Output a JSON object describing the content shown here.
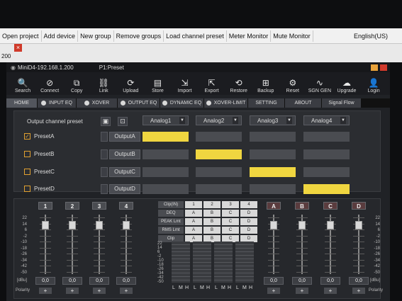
{
  "menu": [
    "Open project",
    "Add device",
    "New group",
    "Remove groups",
    "Load channel preset",
    "Meter Monitor",
    "Mute Monitor"
  ],
  "language": "English(US)",
  "bg_number": "200",
  "window": {
    "title": "MiniD4-192.168.1.200",
    "preset": "P1:Preset"
  },
  "toolbar": [
    {
      "label": "Search",
      "icon": "search-icon",
      "glyph": "🔍"
    },
    {
      "label": "Connect",
      "icon": "connect-icon",
      "glyph": "⊘"
    },
    {
      "label": "Copy",
      "icon": "copy-icon",
      "glyph": "⧉"
    },
    {
      "label": "Link",
      "icon": "link-icon",
      "glyph": "⛓"
    },
    {
      "label": "Upload",
      "icon": "upload-icon",
      "glyph": "⟳"
    },
    {
      "label": "Store",
      "icon": "store-icon",
      "glyph": "▤"
    },
    {
      "label": "Import",
      "icon": "import-icon",
      "glyph": "⇲"
    },
    {
      "label": "Export",
      "icon": "export-icon",
      "glyph": "⇱"
    },
    {
      "label": "Restore",
      "icon": "restore-icon",
      "glyph": "⟲"
    },
    {
      "label": "Backup",
      "icon": "backup-icon",
      "glyph": "⊞"
    },
    {
      "label": "Reset",
      "icon": "reset-icon",
      "glyph": "⚙"
    },
    {
      "label": "SGN GEN",
      "icon": "signal-gen-icon",
      "glyph": "∿"
    },
    {
      "label": "Upgrade",
      "icon": "upgrade-icon",
      "glyph": "☁"
    },
    {
      "label": "Login",
      "icon": "login-icon",
      "glyph": "👤"
    }
  ],
  "tabs": [
    {
      "label": "HOME",
      "active": true,
      "dot": false
    },
    {
      "label": "INPUT EQ",
      "dot": true
    },
    {
      "label": "XOVER",
      "dot": true
    },
    {
      "label": "OUTPUT EQ",
      "dot": true
    },
    {
      "label": "DYNAMIC EQ",
      "dot": true
    },
    {
      "label": "XOVER-LIMIT",
      "dot": true
    },
    {
      "label": "SETTING",
      "dot": false
    },
    {
      "label": "ABOUT",
      "dot": false
    },
    {
      "label": "Signal Flow",
      "dot": false
    }
  ],
  "routing": {
    "header_label": "Output channel preset",
    "inputs": [
      "Analog1",
      "Analog2",
      "Analog3",
      "Analog4"
    ],
    "presets": [
      {
        "name": "PresetA",
        "output": "OutputA",
        "checked": true,
        "assigned": 0
      },
      {
        "name": "PresetB",
        "output": "OutputB",
        "checked": false,
        "assigned": 1
      },
      {
        "name": "PresetC",
        "output": "OutputC",
        "checked": false,
        "assigned": 2
      },
      {
        "name": "PresetD",
        "output": "OutputD",
        "checked": false,
        "assigned": 3
      }
    ],
    "active_color": "#f0d640"
  },
  "mixer": {
    "input_channels": [
      "1",
      "2",
      "3",
      "4"
    ],
    "output_channels": [
      "A",
      "B",
      "C",
      "D"
    ],
    "fader_values": [
      "0,0",
      "0,0",
      "0,0",
      "0,0",
      "0,0",
      "0,0",
      "0,0",
      "0,0"
    ],
    "scale": [
      "22",
      "14",
      "6",
      "-2",
      "-10",
      "-18",
      "-26",
      "-34",
      "-42",
      "-50"
    ],
    "unit": "[dBu]",
    "polarity_label": "Polarity",
    "polarity_symbol": "+",
    "matrix": [
      {
        "label": "Clip(IN)",
        "cells": [
          "1",
          "2",
          "3",
          "4"
        ]
      },
      {
        "label": "DEQ",
        "cells": [
          "A",
          "B",
          "C",
          "D"
        ]
      },
      {
        "label": "PEAK Lmt",
        "cells": [
          "A",
          "B",
          "C",
          "D"
        ]
      },
      {
        "label": "RMS Lmt",
        "cells": [
          "A",
          "B",
          "C",
          "D"
        ]
      },
      {
        "label": "Clip",
        "cells": [
          "A",
          "B",
          "C",
          "D"
        ]
      }
    ],
    "meter_scale": [
      "22",
      "14",
      "6",
      "-2",
      "-10",
      "-18",
      "-26",
      "-34",
      "-42",
      "-50"
    ],
    "meter_labels": [
      "L",
      "M",
      "H",
      "L",
      "M",
      "H",
      "L",
      "M",
      "H",
      "L",
      "M",
      "H"
    ]
  }
}
